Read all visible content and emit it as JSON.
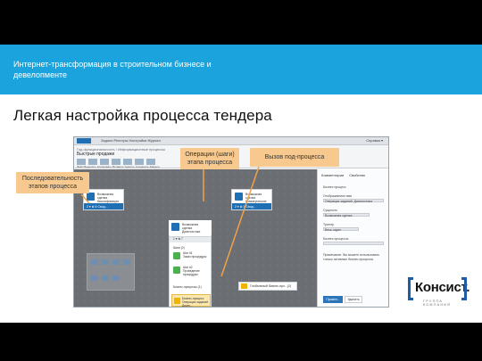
{
  "banner": {
    "title": "Интернет-трансформация в строительном бизнесе и девелопменте"
  },
  "heading": "Легкая настройка процесса тендера",
  "callouts": {
    "sequence": "Последовательность этапов процесса",
    "operations": "Операции (шаги) этапа процесса",
    "subprocess": "Вызов под-процесса"
  },
  "screenshot": {
    "menu": {
      "logo": "Avia",
      "items": "Задачи   Реестры   Настройки   Журнал",
      "right": "Справка ▾"
    },
    "toolbar": {
      "path": "Год функциональность  / Информационные процессы",
      "title": "Быстрые продажи",
      "labels": "Файл   Выделить  Копировать  Вставить  Удалить  Сохранить  Закрыть"
    },
    "stages": [
      {
        "text": "Возможная сделка Квалификация сделки",
        "ctrl": "2 ▾   ⊗ 6        Свод..."
      },
      {
        "text": "Возможная сделка Диагностика",
        "ctrl": "1 ▾   ⊗ 7"
      },
      {
        "text": "Возможная сделка Коммерческое предложение",
        "ctrl": "2 ▾   ⊗ 3        Свод..."
      }
    ],
    "expand": {
      "steps_header": "Шаги (2)",
      "steps": [
        {
          "name": "Шаг #1",
          "desc": "Заказ процедуры"
        },
        {
          "name": "Шаг #2",
          "desc": "Проведение процедуры"
        }
      ],
      "subprocess_header": "Бизнес-процессы (1)",
      "subprocess": "Бизнес-процесс Операции заданий. Диагн..."
    },
    "global_box": "Глобальный бизнес-про...(2)",
    "side": {
      "tabs": [
        "Комментарии",
        "Свойства"
      ],
      "label1": "Бизнес процесс",
      "label2": "Отображаемое имя",
      "value1": "Операции заданий. Диагностика",
      "label3": "Сущность",
      "value2": "Возможная сделка",
      "label4": "Триггер",
      "value3": "Весь отдел",
      "label5": "Бизнес-процессы",
      "note": "Примечание. Вы можете использовать только активные бизнес-процессы",
      "btn_primary": "Примен...",
      "btn_secondary": "Удалить"
    }
  },
  "logo": {
    "word": "Консист.",
    "sub": "ГРУППА КОМПАНИЙ"
  },
  "colors": {
    "banner": "#1aa3dc",
    "callout": "#f7c98e",
    "accent": "#1f6fb5"
  }
}
